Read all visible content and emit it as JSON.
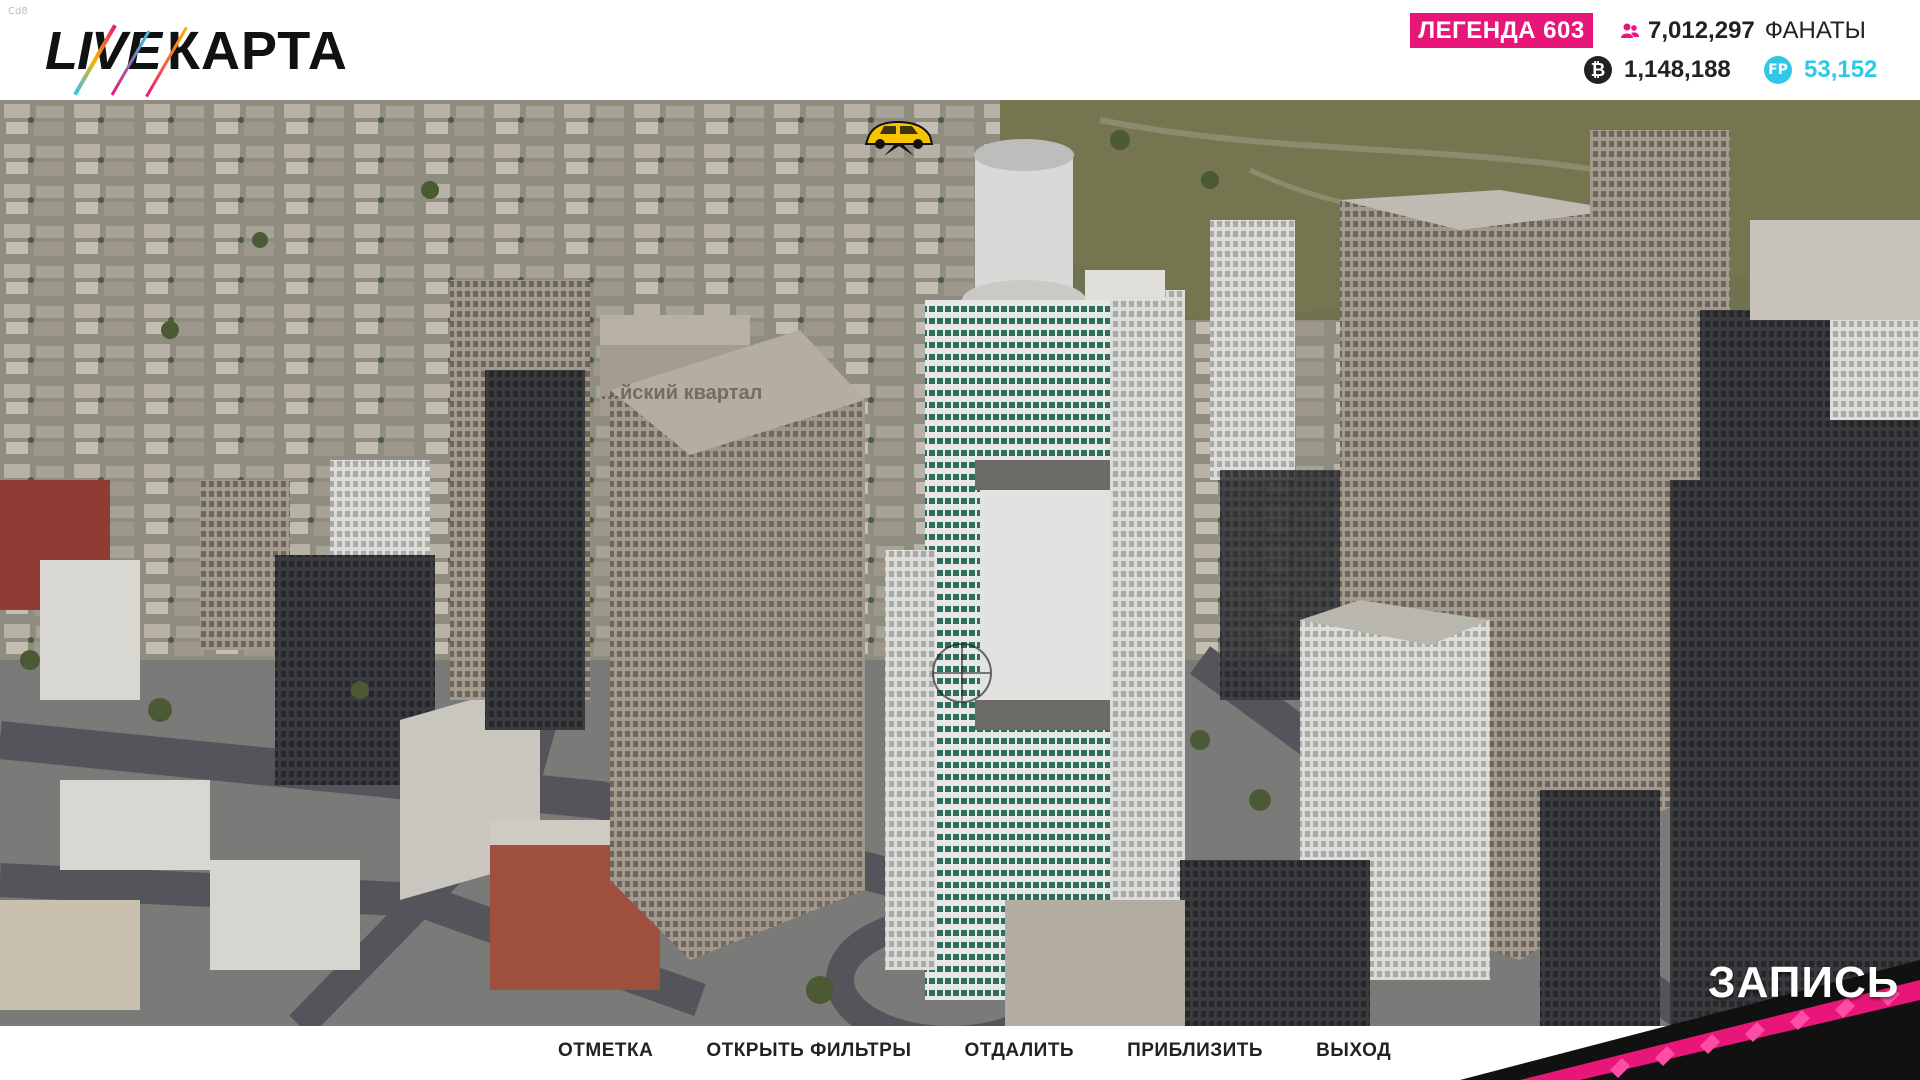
{
  "build_tag": "Cd8",
  "logo": {
    "live": "LIVE",
    "map": "КАРТА"
  },
  "stats": {
    "legend": "ЛЕГЕНДА 603",
    "fans_value": "7,012,297",
    "fans_label": "ФАНАТЫ",
    "credits": "1,148,188",
    "forza_points": "53,152"
  },
  "map": {
    "district_label": "…йский квартал",
    "marker_icon": "car-marker-icon",
    "cursor_icon": "map-cursor-icon"
  },
  "footer": {
    "menu": [
      "ОТМЕТКА",
      "ОТКРЫТЬ ФИЛЬТРЫ",
      "ОТДАЛИТЬ",
      "ПРИБЛИЗИТЬ",
      "ВЫХОД"
    ],
    "record_label": "ЗАПИСЬ"
  },
  "colors": {
    "accent_pink": "#e9167a",
    "forza_cyan": "#31c8e8",
    "marker_yellow": "#f6c400"
  }
}
